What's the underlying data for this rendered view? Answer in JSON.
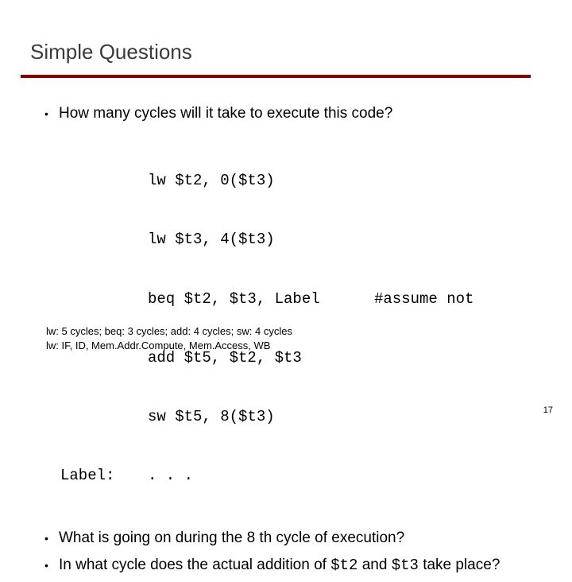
{
  "title": "Simple Questions",
  "bullets": {
    "b1": "How many cycles will it take to execute this code?",
    "b2_pre": "What is going on during the 8 th cycle of execution?",
    "b3_pre": "In what cycle does the actual addition of ",
    "b3_code1": "$t2",
    "b3_mid": " and ",
    "b3_code2": "$t3",
    "b3_post": " take place?"
  },
  "code": {
    "label_blank": "",
    "label_label": "Label:",
    "l1": "lw $t2, 0($t3)",
    "l2": "lw $t3, 4($t3)",
    "l3": "beq $t2, $t3, Label",
    "c3": "#assume not",
    "l4": "add $t5, $t2, $t3",
    "l5": "sw $t5, 8($t3)",
    "l6": ". . ."
  },
  "footnotes": {
    "f1": "lw: 5 cycles; beq: 3 cycles; add: 4 cycles; sw: 4 cycles",
    "f2": "lw: IF, ID, Mem.Addr.Compute, Mem.Access, WB"
  },
  "page": "17"
}
